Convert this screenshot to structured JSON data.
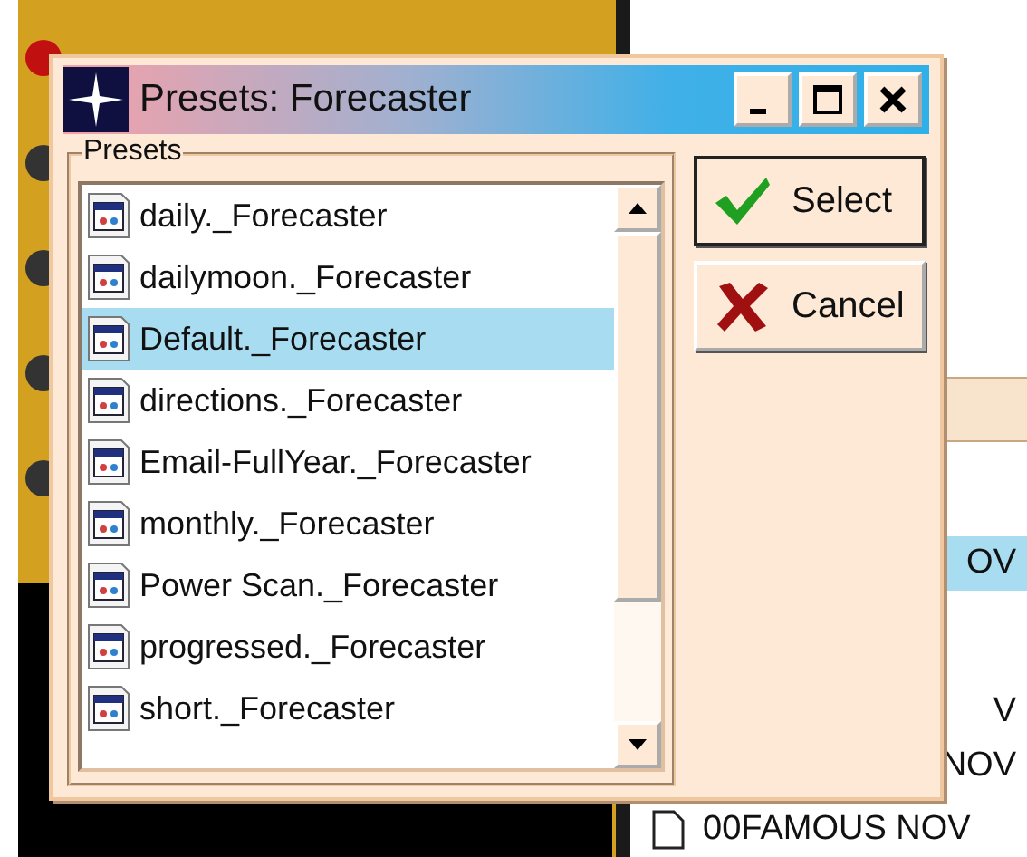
{
  "background_rows": [
    {
      "text": "OV",
      "selected": true,
      "kind": "partial"
    },
    {
      "text": "V",
      "selected": false,
      "kind": "partial"
    },
    {
      "text": "NOV",
      "selected": false,
      "kind": "partial"
    },
    {
      "text": "00FAMOUS NOV",
      "selected": false,
      "kind": "file"
    }
  ],
  "dialog": {
    "title": "Presets: Forecaster",
    "group_label": "Presets",
    "presets": [
      {
        "label": "daily._Forecaster",
        "selected": false
      },
      {
        "label": "dailymoon._Forecaster",
        "selected": false
      },
      {
        "label": "Default._Forecaster",
        "selected": true
      },
      {
        "label": "directions._Forecaster",
        "selected": false
      },
      {
        "label": "Email-FullYear._Forecaster",
        "selected": false
      },
      {
        "label": "monthly._Forecaster",
        "selected": false
      },
      {
        "label": "Power Scan._Forecaster",
        "selected": false
      },
      {
        "label": "progressed._Forecaster",
        "selected": false
      },
      {
        "label": "short._Forecaster",
        "selected": false
      }
    ],
    "buttons": [
      {
        "label": "Select",
        "kind": "ok"
      },
      {
        "label": "Cancel",
        "kind": "cancel"
      }
    ]
  }
}
